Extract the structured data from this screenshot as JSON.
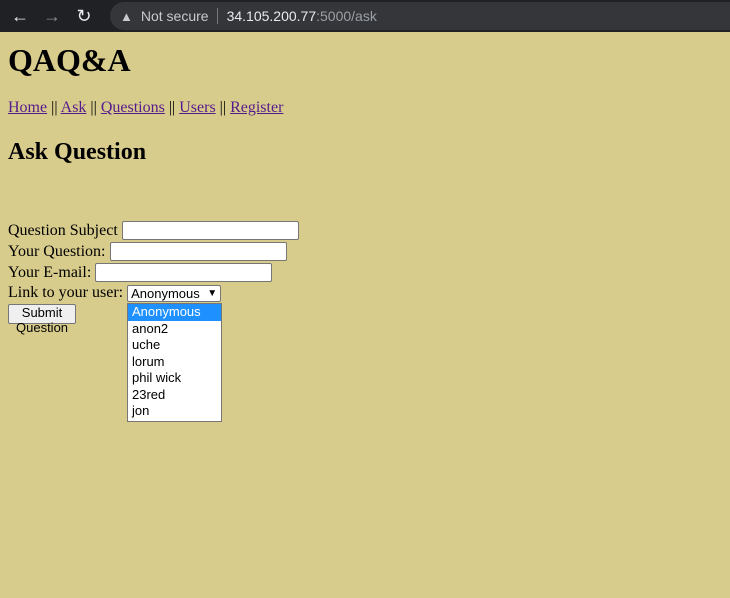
{
  "browser": {
    "security_label": "Not secure",
    "url_host": "34.105.200.77",
    "url_path": ":5000/ask"
  },
  "site_title": "QAQ&A",
  "nav": {
    "home": "Home",
    "ask": "Ask",
    "questions": "Questions",
    "users": "Users",
    "register": "Register",
    "separator": "||"
  },
  "page_title": "Ask Question",
  "form": {
    "subject_label": "Question Subject",
    "subject_value": "",
    "question_label": "Your Question:",
    "question_value": "",
    "email_label": "Your E-mail:",
    "email_value": "",
    "user_label": "Link to your user:",
    "user_selected": "Anonymous",
    "user_options": [
      "Anonymous",
      "anon2",
      "uche",
      "lorum",
      "phil wick",
      "23red",
      "jon"
    ],
    "submit_label": "Submit Question"
  },
  "colors": {
    "page_background": "#d8cc8d",
    "link": "#551a8b",
    "option_highlight": "#1e90ff"
  }
}
